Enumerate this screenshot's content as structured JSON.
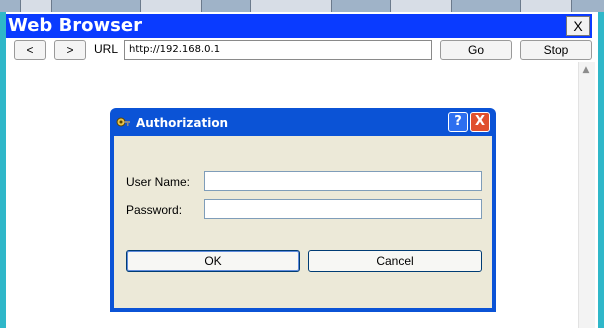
{
  "window": {
    "title": "Web Browser",
    "close_label": "X"
  },
  "toolbar": {
    "back_label": "<",
    "forward_label": ">",
    "url_label": "URL",
    "url_value": "http://192.168.0.1",
    "go_label": "Go",
    "stop_label": "Stop"
  },
  "scrollbar": {
    "up_icon": "▲"
  },
  "dialog": {
    "title": "Authorization",
    "help_label": "?",
    "close_label": "X",
    "username_label": "User Name:",
    "password_label": "Password:",
    "username_value": "",
    "password_value": "",
    "ok_label": "OK",
    "cancel_label": "Cancel"
  },
  "colors": {
    "titlebar": "#0a3bff",
    "dialog_frame": "#0b53d6",
    "dialog_body": "#ece9d8",
    "frame": "#2fb7c9"
  }
}
